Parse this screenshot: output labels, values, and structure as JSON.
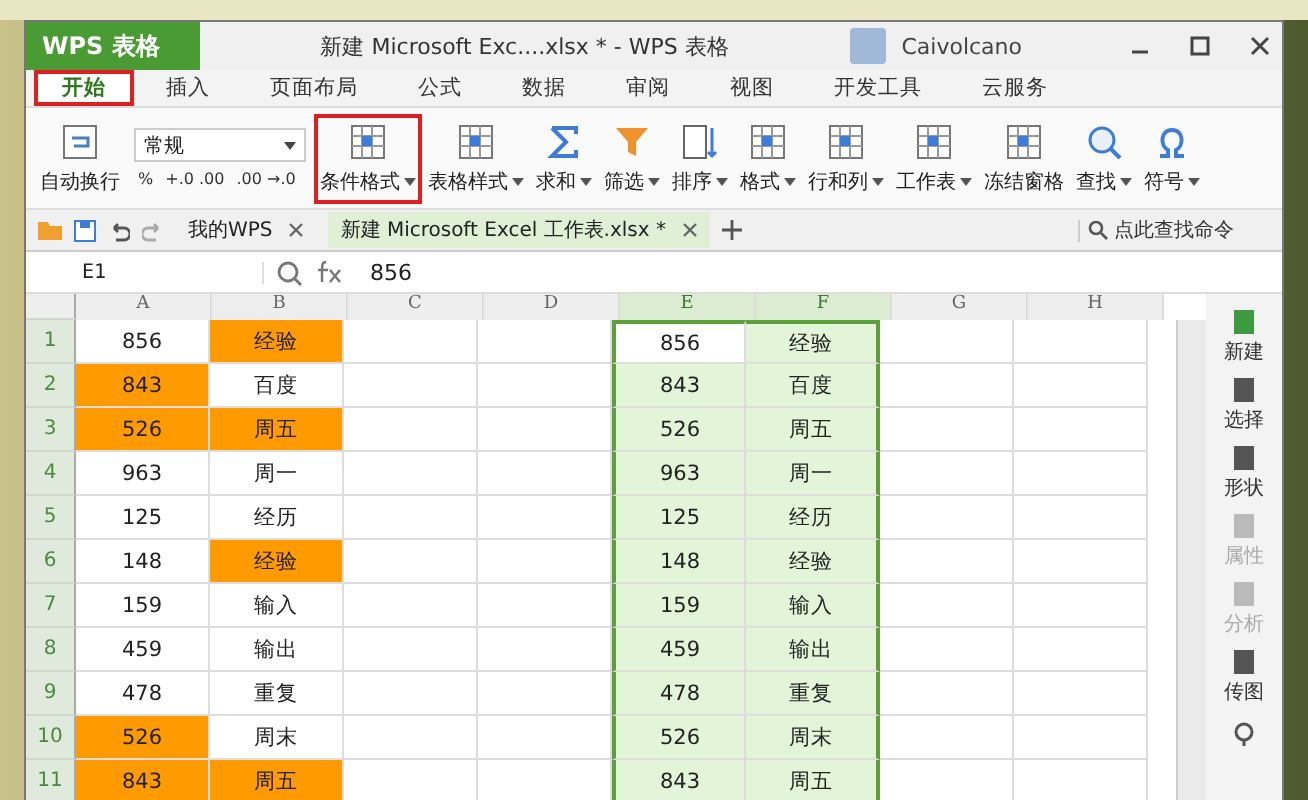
{
  "app_menu": {
    "label": "WPS 表格"
  },
  "window": {
    "title": "新建 Microsoft Exc....xlsx * - WPS 表格",
    "user": "Caivolcano"
  },
  "tabs": [
    {
      "label": "开始",
      "selected": true,
      "outlined": true
    },
    {
      "label": "插入",
      "selected": false,
      "outlined": false
    },
    {
      "label": "页面布局",
      "selected": false,
      "outlined": false
    },
    {
      "label": "公式",
      "selected": false,
      "outlined": false
    },
    {
      "label": "数据",
      "selected": false,
      "outlined": false
    },
    {
      "label": "审阅",
      "selected": false,
      "outlined": false
    },
    {
      "label": "视图",
      "selected": false,
      "outlined": false
    },
    {
      "label": "开发工具",
      "selected": false,
      "outlined": false
    },
    {
      "label": "云服务",
      "selected": false,
      "outlined": false
    }
  ],
  "ribbon": {
    "wrap_button": "自动换行",
    "number_format": "常规",
    "small_buttons": [
      "%",
      "+.0 .00",
      ".00 →.0"
    ],
    "buttons": [
      {
        "label": "条件格式",
        "dropdown": true,
        "outlined": true
      },
      {
        "label": "表格样式",
        "dropdown": true,
        "outlined": false
      },
      {
        "label": "求和",
        "dropdown": true,
        "outlined": false
      },
      {
        "label": "筛选",
        "dropdown": true,
        "outlined": false
      },
      {
        "label": "排序",
        "dropdown": true,
        "outlined": false
      },
      {
        "label": "格式",
        "dropdown": true,
        "outlined": false
      },
      {
        "label": "行和列",
        "dropdown": true,
        "outlined": false
      },
      {
        "label": "工作表",
        "dropdown": true,
        "outlined": false
      },
      {
        "label": "冻结窗格",
        "dropdown": false,
        "outlined": false
      },
      {
        "label": "查找",
        "dropdown": true,
        "outlined": false
      },
      {
        "label": "符号",
        "dropdown": true,
        "outlined": false
      }
    ]
  },
  "doc_tabs": [
    {
      "label": "我的WPS",
      "selected": false
    },
    {
      "label": "新建 Microsoft Excel 工作表.xlsx *",
      "selected": true
    }
  ],
  "command_search": {
    "placeholder": "点此查找命令"
  },
  "formula_bar": {
    "name_box": "E1",
    "value": "856"
  },
  "columns": [
    "A",
    "B",
    "C",
    "D",
    "E",
    "F",
    "G",
    "H"
  ],
  "rows": [
    {
      "number": "1",
      "a": {
        "text": "856",
        "highlighted": false
      },
      "b": {
        "text": "经验",
        "highlighted": true
      },
      "e": {
        "text": "856",
        "active": true
      },
      "f": "经验"
    },
    {
      "number": "2",
      "a": {
        "text": "843",
        "highlighted": true
      },
      "b": {
        "text": "百度",
        "highlighted": false
      },
      "e": {
        "text": "843",
        "active": false
      },
      "f": "百度"
    },
    {
      "number": "3",
      "a": {
        "text": "526",
        "highlighted": true
      },
      "b": {
        "text": "周五",
        "highlighted": true
      },
      "e": {
        "text": "526",
        "active": false
      },
      "f": "周五"
    },
    {
      "number": "4",
      "a": {
        "text": "963",
        "highlighted": false
      },
      "b": {
        "text": "周一",
        "highlighted": false
      },
      "e": {
        "text": "963",
        "active": false
      },
      "f": "周一"
    },
    {
      "number": "5",
      "a": {
        "text": "125",
        "highlighted": false
      },
      "b": {
        "text": "经历",
        "highlighted": false
      },
      "e": {
        "text": "125",
        "active": false
      },
      "f": "经历"
    },
    {
      "number": "6",
      "a": {
        "text": "148",
        "highlighted": false
      },
      "b": {
        "text": "经验",
        "highlighted": true
      },
      "e": {
        "text": "148",
        "active": false
      },
      "f": "经验"
    },
    {
      "number": "7",
      "a": {
        "text": "159",
        "highlighted": false
      },
      "b": {
        "text": "输入",
        "highlighted": false
      },
      "e": {
        "text": "159",
        "active": false
      },
      "f": "输入"
    },
    {
      "number": "8",
      "a": {
        "text": "459",
        "highlighted": false
      },
      "b": {
        "text": "输出",
        "highlighted": false
      },
      "e": {
        "text": "459",
        "active": false
      },
      "f": "输出"
    },
    {
      "number": "9",
      "a": {
        "text": "478",
        "highlighted": false
      },
      "b": {
        "text": "重复",
        "highlighted": false
      },
      "e": {
        "text": "478",
        "active": false
      },
      "f": "重复"
    },
    {
      "number": "10",
      "a": {
        "text": "526",
        "highlighted": true
      },
      "b": {
        "text": "周末",
        "highlighted": false
      },
      "e": {
        "text": "526",
        "active": false
      },
      "f": "周末"
    },
    {
      "number": "11",
      "a": {
        "text": "843",
        "highlighted": true
      },
      "b": {
        "text": "周五",
        "highlighted": true
      },
      "e": {
        "text": "843",
        "active": false
      },
      "f": "周五"
    }
  ],
  "side_panel": [
    {
      "label": "新建",
      "disabled": false
    },
    {
      "label": "选择",
      "disabled": false
    },
    {
      "label": "形状",
      "disabled": false
    },
    {
      "label": "属性",
      "disabled": true
    },
    {
      "label": "分析",
      "disabled": true
    },
    {
      "label": "传图",
      "disabled": false
    }
  ]
}
